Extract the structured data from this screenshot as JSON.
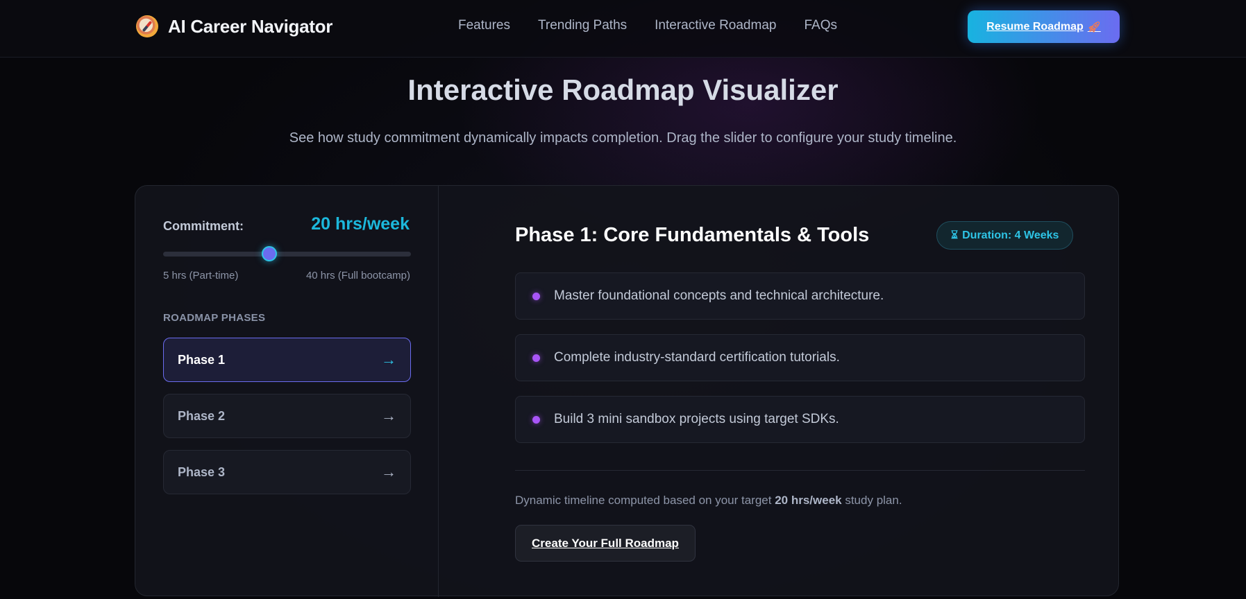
{
  "header": {
    "brand_name": "AI Career Navigator",
    "brand_icon": "compass-icon",
    "nav": [
      {
        "label": "Features"
      },
      {
        "label": "Trending Paths"
      },
      {
        "label": "Interactive Roadmap"
      },
      {
        "label": "FAQs"
      }
    ],
    "resume_label": "Resume Roadmap",
    "resume_icon": "rocket-icon"
  },
  "hero": {
    "title": "Interactive Roadmap Visualizer",
    "subtitle": "See how study commitment dynamically impacts completion. Drag the slider to configure your study timeline."
  },
  "commitment": {
    "label": "Commitment:",
    "value_text": "20 hrs/week",
    "hours": 20,
    "min_hours": 5,
    "max_hours": 40,
    "min_label": "5 hrs (Part-time)",
    "max_label": "40 hrs (Full bootcamp)"
  },
  "phases": {
    "title": "ROADMAP PHASES",
    "items": [
      {
        "label": "Phase 1",
        "arrow": "→",
        "active": true
      },
      {
        "label": "Phase 2",
        "arrow": "→",
        "active": false
      },
      {
        "label": "Phase 3",
        "arrow": "→",
        "active": false
      }
    ]
  },
  "detail": {
    "title": "Phase 1: Core Fundamentals & Tools",
    "duration_icon": "hourglass-icon",
    "duration_label": "Duration: 4 Weeks",
    "tasks": [
      {
        "text": "Master foundational concepts and technical architecture."
      },
      {
        "text": "Complete industry-standard certification tutorials."
      },
      {
        "text": "Build 3 mini sandbox projects using target SDKs."
      }
    ],
    "note_prefix": "Dynamic timeline computed based on your target ",
    "note_value": "20 hrs/week",
    "note_suffix": " study plan.",
    "create_label": "Create Your Full Roadmap"
  },
  "colors": {
    "accent_cyan": "#1cb8dc",
    "accent_indigo": "#6b6cf0",
    "accent_purple": "#a855f7",
    "background": "#07070b"
  }
}
